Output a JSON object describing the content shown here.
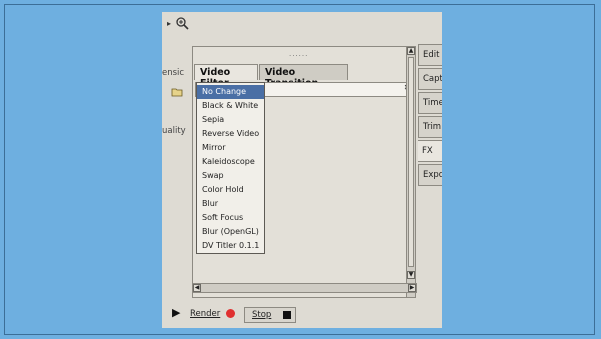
{
  "left_labels": {
    "top": "ensic",
    "quality": "uality"
  },
  "tabs": [
    {
      "label": "Video Filter",
      "active": true
    },
    {
      "label": "Video Transition",
      "active": false
    }
  ],
  "filter_dropdown": {
    "selected": "No Change",
    "options": [
      "No Change",
      "Black & White",
      "Sepia",
      "Reverse Video",
      "Mirror",
      "Kaleidoscope",
      "Swap",
      "Color Hold",
      "Blur",
      "Soft Focus",
      "Blur (OpenGL)",
      "DV Titler 0.1.1"
    ]
  },
  "side_tabs": [
    "Edit",
    "Capt",
    "Time",
    "Trim",
    "FX",
    "Expo"
  ],
  "active_side_tab": "FX",
  "bottom": {
    "render_label": "Render",
    "stop_label": "Stop"
  },
  "colors": {
    "background": "#6eafe0",
    "selection": "#4a6fa5",
    "render_dot": "#e03030"
  },
  "icons": [
    "play-arrow-icon",
    "zoom-icon",
    "folder-icon",
    "play-icon",
    "record-icon",
    "stop-icon"
  ]
}
